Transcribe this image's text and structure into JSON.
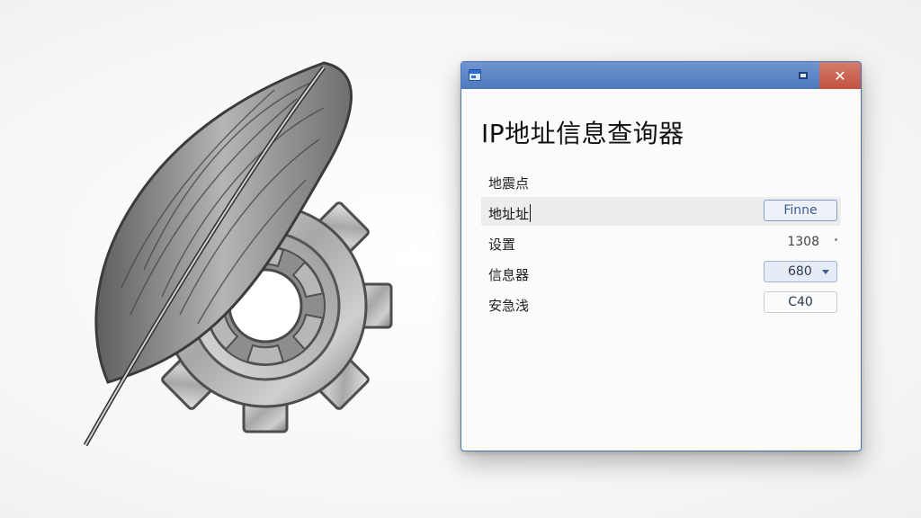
{
  "window": {
    "title": "IP地址信息查询器"
  },
  "rows": [
    {
      "label": "地震点"
    },
    {
      "label": "地址址",
      "value": "Finne"
    },
    {
      "label": "设置",
      "value": "1308"
    },
    {
      "label": "信息器",
      "value": "680"
    },
    {
      "label": "安急浅",
      "value": "C40"
    }
  ],
  "icons": {
    "logo": "feather-and-gear-logo",
    "app": "window-app-icon",
    "maximize": "maximize-icon",
    "close": "close-icon",
    "dropdown": "chevron-down-icon"
  }
}
